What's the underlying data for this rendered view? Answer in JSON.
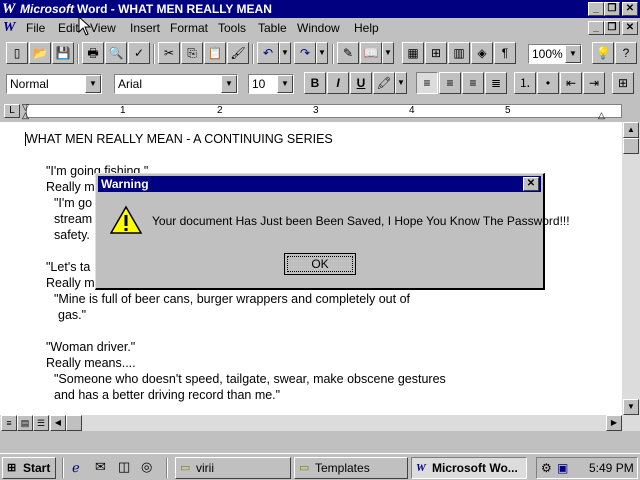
{
  "titlebar": {
    "app_name": "Microsoft",
    "doc_title": "Word - WHAT MEN REALLY MEAN"
  },
  "menu": [
    "File",
    "Edit",
    "View",
    "Insert",
    "Format",
    "Tools",
    "Table",
    "Window",
    "Help"
  ],
  "formatting": {
    "style": "Normal",
    "font": "Arial",
    "size": "10",
    "zoom": "100%"
  },
  "ruler": {
    "numbers": [
      "1",
      "2",
      "3",
      "4",
      "5"
    ]
  },
  "document": {
    "lines": [
      "WHAT MEN REALLY MEAN - A CONTINUING SERIES",
      "\"I'm going fishing.\"",
      "Really m",
      "\"I'm go",
      "stream",
      "safety.",
      "\"Let's ta",
      "Really m",
      "\"Mine is full of beer cans, burger wrappers and completely out of",
      "gas.\"",
      "\"Woman driver.\"",
      "Really means....",
      "\"Someone who doesn't speed, tailgate, swear, make obscene gestures",
      "and has a better driving record than me.\""
    ]
  },
  "dialog": {
    "title": "Warning",
    "message": "Your document Has Just been Been Saved, I Hope You Know The Password!!!",
    "ok_label": "OK"
  },
  "taskbar": {
    "start_label": "Start",
    "tasks": [
      "virii",
      "Templates",
      "Microsoft Wo..."
    ],
    "clock": "5:49 PM"
  },
  "colors": {
    "titlebar": "#000080",
    "face": "#c0c0c0",
    "warning_icon": "#ffff00"
  }
}
